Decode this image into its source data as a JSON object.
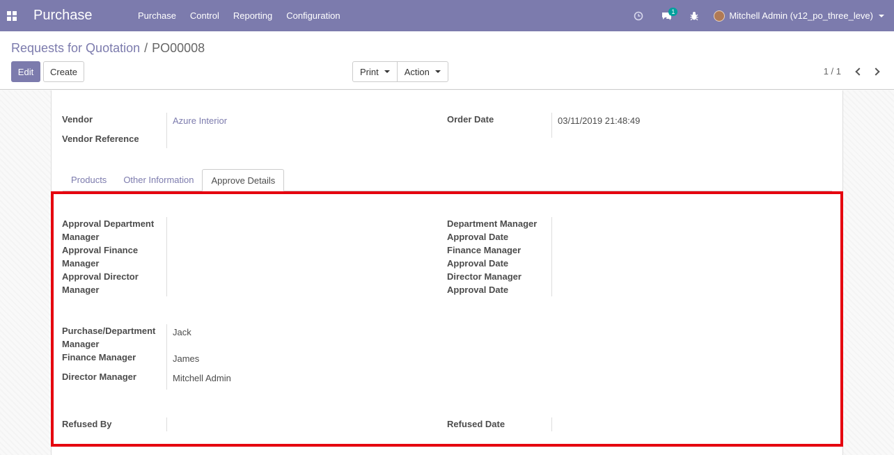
{
  "navbar": {
    "app_name": "Purchase",
    "menu": [
      "Purchase",
      "Control",
      "Reporting",
      "Configuration"
    ],
    "chat_count": "1",
    "user_name": "Mitchell Admin (v12_po_three_leve)"
  },
  "control": {
    "breadcrumb_parent": "Requests for Quotation",
    "breadcrumb_separator": "/",
    "breadcrumb_current": "PO00008",
    "edit_label": "Edit",
    "create_label": "Create",
    "print_label": "Print",
    "action_label": "Action",
    "pager": "1 / 1"
  },
  "form": {
    "vendor_label": "Vendor",
    "vendor_value": "Azure Interior",
    "vendor_ref_label": "Vendor Reference",
    "order_date_label": "Order Date",
    "order_date_value": "03/11/2019 21:48:49",
    "tabs": [
      "Products",
      "Other Information",
      "Approve Details"
    ],
    "approval": {
      "approval_dept_manager_l1": "Approval Department",
      "approval_dept_manager_l2": "Manager",
      "approval_fin_manager_l1": "Approval Finance",
      "approval_fin_manager_l2": "Manager",
      "approval_dir_manager_l1": "Approval Director",
      "approval_dir_manager_l2": "Manager",
      "dept_date_l1": "Department Manager",
      "dept_date_l2": "Approval Date",
      "fin_date_l1": "Finance Manager",
      "fin_date_l2": "Approval Date",
      "dir_date_l1": "Director Manager",
      "dir_date_l2": "Approval Date",
      "purchase_dept_l1": "Purchase/Department",
      "purchase_dept_l2": "Manager",
      "purchase_dept_value": "Jack",
      "finance_manager_label": "Finance Manager",
      "finance_manager_value": "James",
      "director_manager_label": "Director Manager",
      "director_manager_value": "Mitchell Admin",
      "refused_by_label": "Refused By",
      "refused_date_label": "Refused Date"
    }
  },
  "colors": {
    "brand": "#7c7bad",
    "highlight": "#e5000e"
  }
}
